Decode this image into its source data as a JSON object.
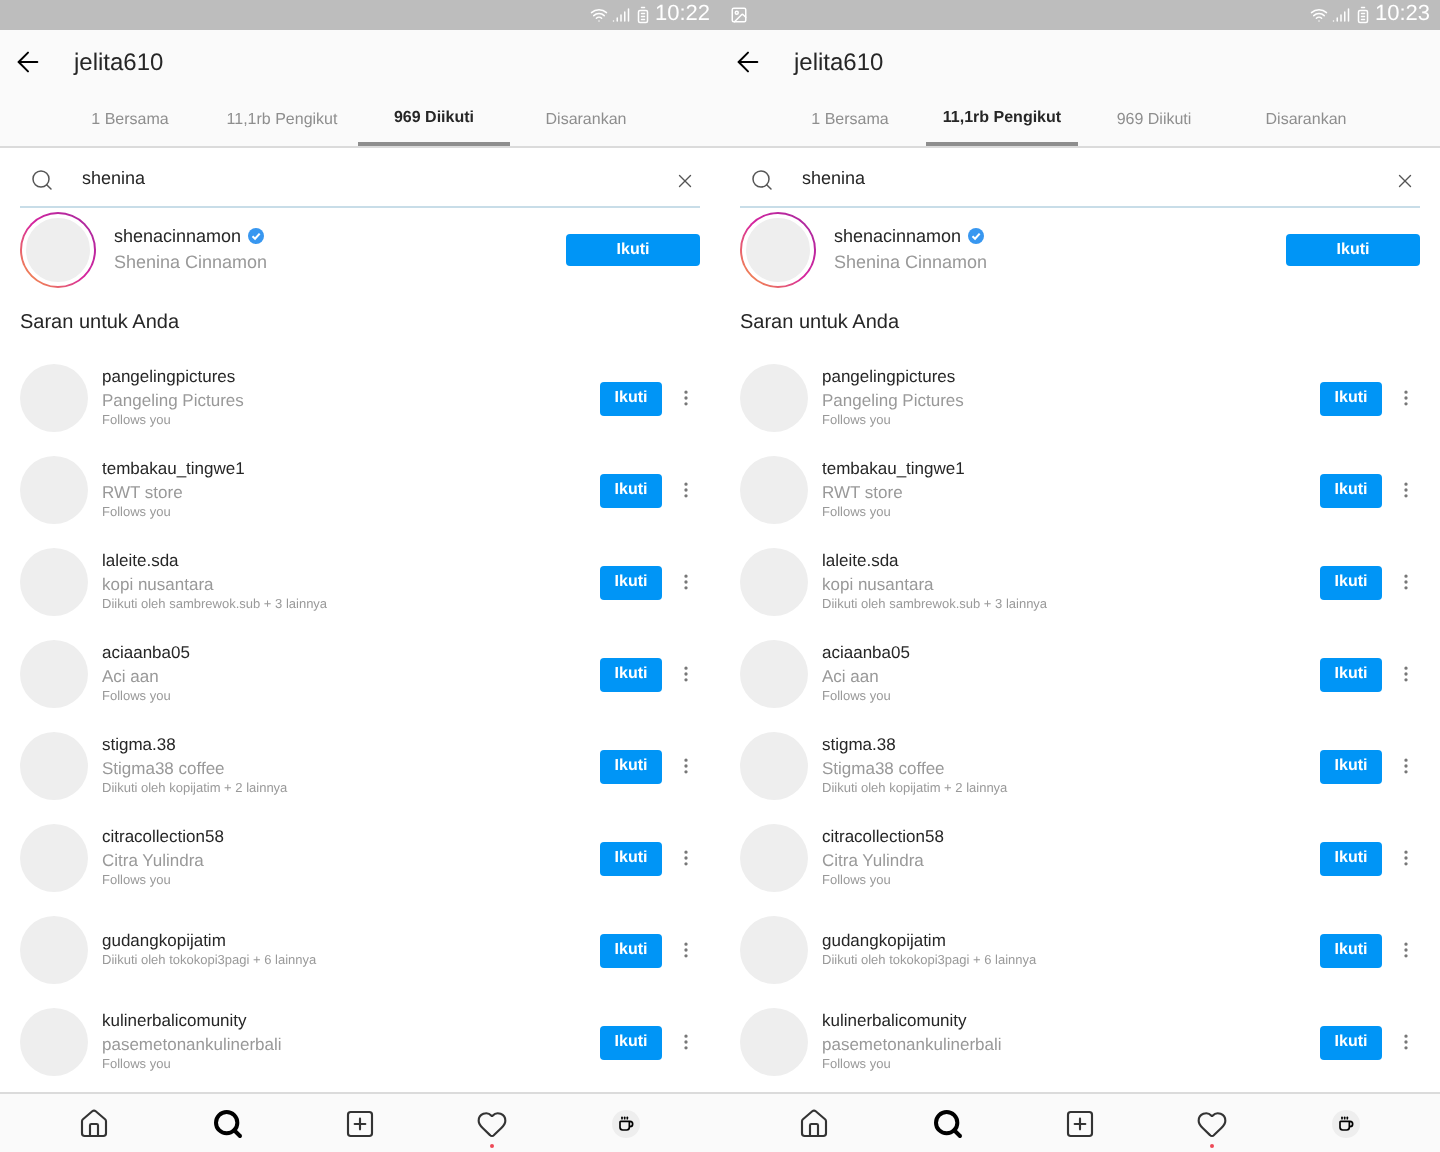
{
  "screens": [
    {
      "status_bar": {
        "time": "10:22",
        "image_notification": false
      },
      "title": "jelita610",
      "tabs": [
        {
          "label": "1 Bersama",
          "selected": false
        },
        {
          "label": "11,1rb Pengikut",
          "selected": false
        },
        {
          "label": "969 Diikuti",
          "selected": true
        },
        {
          "label": "Disarankan",
          "selected": false
        }
      ],
      "search": {
        "value": "shenina"
      },
      "top_result": {
        "username": "shenacinnamon",
        "name": "Shenina Cinnamon",
        "verified": true,
        "button": "Ikuti"
      },
      "section_title": "Saran untuk Anda",
      "suggestions": [
        {
          "username": "pangelingpictures",
          "name": "Pangeling Pictures",
          "subtitle": "Follows you",
          "button": "Ikuti"
        },
        {
          "username": "tembakau_tingwe1",
          "name": "RWT store",
          "subtitle": "Follows you",
          "button": "Ikuti"
        },
        {
          "username": "laleite.sda",
          "name": "kopi nusantara",
          "subtitle": "Diikuti oleh sambrewok.sub + 3 lainnya",
          "button": "Ikuti"
        },
        {
          "username": "aciaanba05",
          "name": "Aci aan",
          "subtitle": "Follows you",
          "button": "Ikuti"
        },
        {
          "username": "stigma.38",
          "name": "Stigma38 coffee",
          "subtitle": "Diikuti oleh kopijatim + 2 lainnya",
          "button": "Ikuti"
        },
        {
          "username": "citracollection58",
          "name": "Citra Yulindra",
          "subtitle": "Follows you",
          "button": "Ikuti"
        },
        {
          "username": "gudangkopijatim",
          "subtitle": "Diikuti oleh tokokopi3pagi + 6 lainnya",
          "button": "Ikuti"
        },
        {
          "username": "kulinerbalicomunity",
          "name": "pasemetonankulinerbali",
          "subtitle": "Follows you",
          "button": "Ikuti"
        }
      ],
      "nav": [
        {
          "kind": "home",
          "selected": false,
          "badge": false
        },
        {
          "kind": "search",
          "selected": true,
          "badge": false
        },
        {
          "kind": "add",
          "selected": false,
          "badge": false
        },
        {
          "kind": "heart",
          "selected": false,
          "badge": true
        },
        {
          "kind": "profile",
          "selected": false,
          "badge": false
        }
      ]
    },
    {
      "status_bar": {
        "time": "10:23",
        "image_notification": true
      },
      "title": "jelita610",
      "tabs": [
        {
          "label": "1 Bersama",
          "selected": false
        },
        {
          "label": "11,1rb Pengikut",
          "selected": true
        },
        {
          "label": "969 Diikuti",
          "selected": false
        },
        {
          "label": "Disarankan",
          "selected": false
        }
      ],
      "search": {
        "value": "shenina"
      },
      "top_result": {
        "username": "shenacinnamon",
        "name": "Shenina Cinnamon",
        "verified": true,
        "button": "Ikuti"
      },
      "section_title": "Saran untuk Anda",
      "suggestions": [
        {
          "username": "pangelingpictures",
          "name": "Pangeling Pictures",
          "subtitle": "Follows you",
          "button": "Ikuti"
        },
        {
          "username": "tembakau_tingwe1",
          "name": "RWT store",
          "subtitle": "Follows you",
          "button": "Ikuti"
        },
        {
          "username": "laleite.sda",
          "name": "kopi nusantara",
          "subtitle": "Diikuti oleh sambrewok.sub + 3 lainnya",
          "button": "Ikuti"
        },
        {
          "username": "aciaanba05",
          "name": "Aci aan",
          "subtitle": "Follows you",
          "button": "Ikuti"
        },
        {
          "username": "stigma.38",
          "name": "Stigma38 coffee",
          "subtitle": "Diikuti oleh kopijatim + 2 lainnya",
          "button": "Ikuti"
        },
        {
          "username": "citracollection58",
          "name": "Citra Yulindra",
          "subtitle": "Follows you",
          "button": "Ikuti"
        },
        {
          "username": "gudangkopijatim",
          "subtitle": "Diikuti oleh tokokopi3pagi + 6 lainnya",
          "button": "Ikuti"
        },
        {
          "username": "kulinerbalicomunity",
          "name": "pasemetonankulinerbali",
          "subtitle": "Follows you",
          "button": "Ikuti"
        }
      ],
      "nav": [
        {
          "kind": "home",
          "selected": false,
          "badge": false
        },
        {
          "kind": "search",
          "selected": true,
          "badge": false
        },
        {
          "kind": "add",
          "selected": false,
          "badge": false
        },
        {
          "kind": "heart",
          "selected": false,
          "badge": true
        },
        {
          "kind": "profile",
          "selected": false,
          "badge": false
        }
      ]
    }
  ]
}
